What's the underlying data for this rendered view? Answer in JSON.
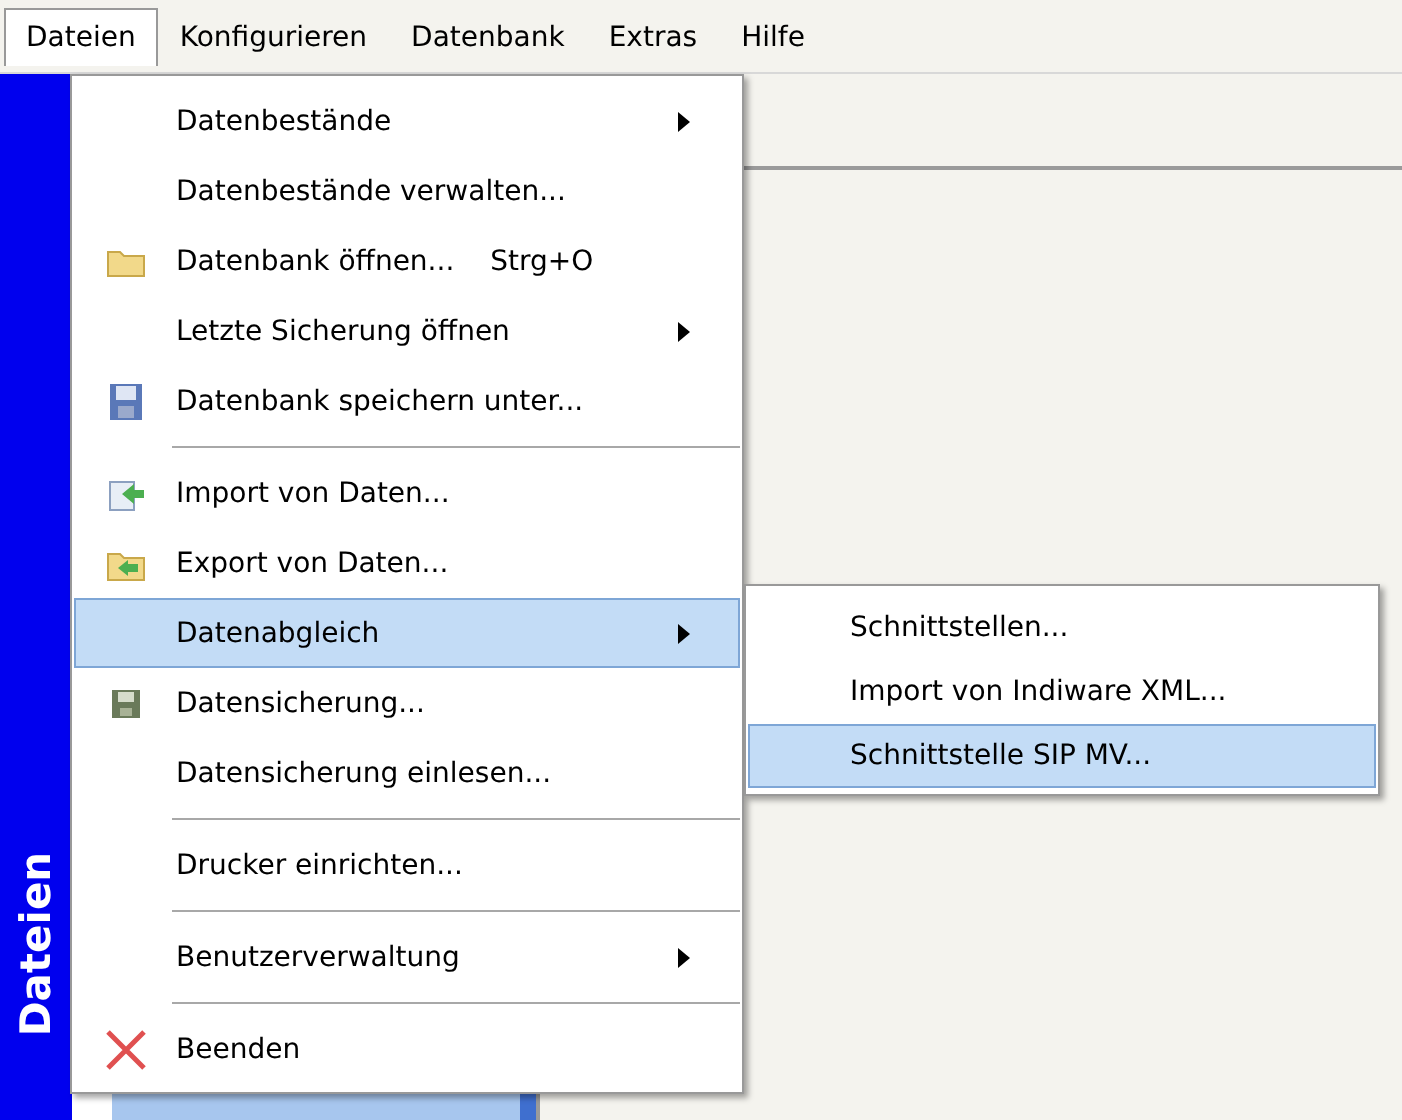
{
  "menubar": [
    {
      "label": "Dateien",
      "selected": true
    },
    {
      "label": "Konfigurieren",
      "selected": false
    },
    {
      "label": "Datenbank",
      "selected": false
    },
    {
      "label": "Extras",
      "selected": false
    },
    {
      "label": "Hilfe",
      "selected": false
    }
  ],
  "sidebar": {
    "title": "Dateien"
  },
  "menu": {
    "items": [
      {
        "kind": "item",
        "label": "Datenbestände",
        "submenu": true,
        "selected": false
      },
      {
        "kind": "item",
        "label": "Datenbestände verwalten...",
        "selected": false
      },
      {
        "kind": "item",
        "label": "Datenbank öffnen...",
        "shortcut": "Strg+O",
        "selected": false
      },
      {
        "kind": "item",
        "label": "Letzte Sicherung öffnen",
        "submenu": true,
        "selected": false
      },
      {
        "kind": "item",
        "label": "Datenbank speichern unter...",
        "selected": false
      },
      {
        "kind": "separator"
      },
      {
        "kind": "item",
        "label": "Import von Daten...",
        "selected": false
      },
      {
        "kind": "item",
        "label": "Export von Daten...",
        "selected": false
      },
      {
        "kind": "item",
        "label": "Datenabgleich",
        "submenu": true,
        "selected": true
      },
      {
        "kind": "item",
        "label": "Datensicherung...",
        "selected": false
      },
      {
        "kind": "item",
        "label": "Datensicherung einlesen...",
        "selected": false
      },
      {
        "kind": "separator"
      },
      {
        "kind": "item",
        "label": "Drucker einrichten...",
        "selected": false
      },
      {
        "kind": "separator"
      },
      {
        "kind": "item",
        "label": "Benutzerverwaltung",
        "submenu": true,
        "selected": false
      },
      {
        "kind": "separator"
      },
      {
        "kind": "item",
        "label": "Beenden",
        "selected": false
      }
    ]
  },
  "submenu": {
    "items": [
      {
        "label": "Schnittstellen...",
        "selected": false
      },
      {
        "label": "Import von Indiware XML...",
        "selected": false
      },
      {
        "label": "Schnittstelle SIP MV...",
        "selected": true
      }
    ]
  }
}
